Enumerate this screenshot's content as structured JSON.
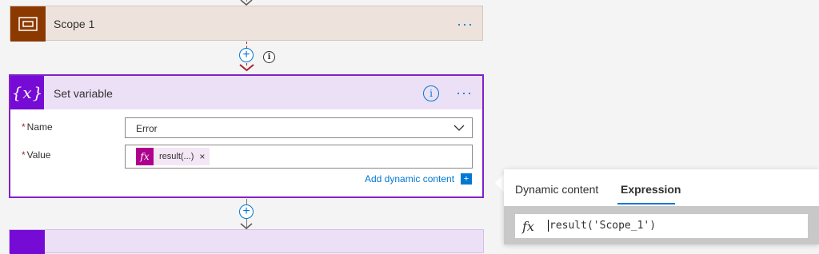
{
  "scope_card": {
    "title": "Scope 1",
    "more_label": "···"
  },
  "connector": {
    "add_label": "+",
    "info_label": "i"
  },
  "set_variable": {
    "title": "Set variable",
    "info_label": "i",
    "more_label": "···",
    "name_field": {
      "required_mark": "*",
      "label": "Name",
      "value": "Error"
    },
    "value_field": {
      "required_mark": "*",
      "label": "Value",
      "token": {
        "icon": "fx",
        "text": "result(...)",
        "remove": "×"
      }
    },
    "add_dynamic_content": "Add dynamic content",
    "add_dynamic_icon": "+"
  },
  "bottom_connector": {
    "add_label": "+"
  },
  "expression_panel": {
    "tabs": [
      {
        "label": "Dynamic content",
        "active": false
      },
      {
        "label": "Expression",
        "active": true
      }
    ],
    "fx_icon": "fx",
    "expression": "result('Scope_1')"
  },
  "colors": {
    "scope_brown": "#8c3900",
    "variable_purple": "#770bd6",
    "card_border_purple": "#8121c7",
    "token_magenta": "#ad008c",
    "link_blue": "#0078d4",
    "required_red": "#a4262c"
  }
}
